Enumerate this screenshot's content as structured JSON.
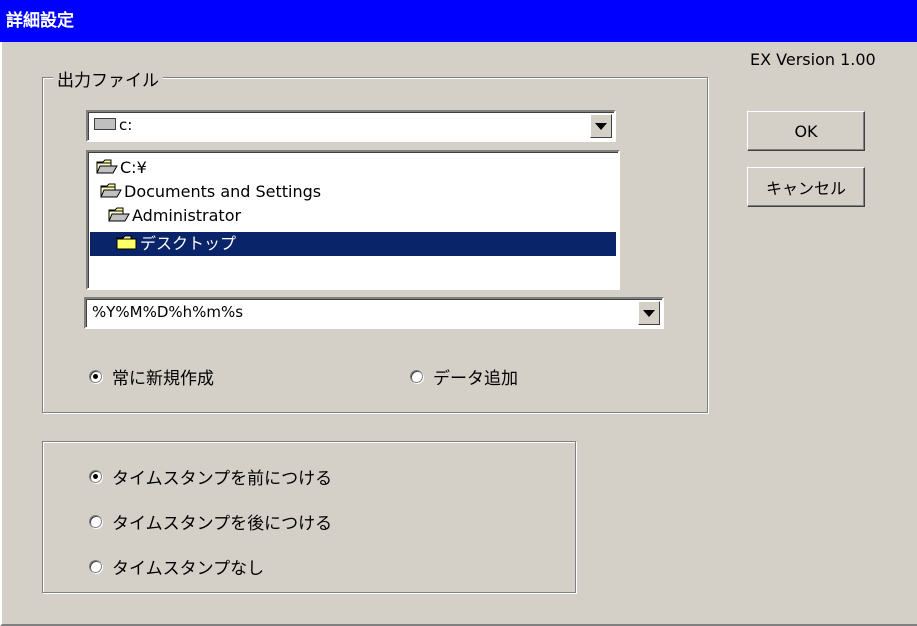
{
  "window": {
    "title": "詳細設定",
    "version": "EX Version 1.00"
  },
  "output_group": {
    "legend": "出力ファイル",
    "drive": {
      "value": "c:",
      "icon": "drive-icon"
    },
    "directories": [
      {
        "label": "C:¥",
        "icon": "open-folder-icon",
        "selected": false
      },
      {
        "label": "Documents and Settings",
        "icon": "open-folder-icon",
        "selected": false
      },
      {
        "label": "Administrator",
        "icon": "open-folder-icon",
        "selected": false
      },
      {
        "label": "デスクトップ",
        "icon": "folder-icon",
        "selected": true
      }
    ],
    "filename_format": "%Y%M%D%h%m%s",
    "mode_options": [
      {
        "label": "常に新規作成",
        "checked": true
      },
      {
        "label": "データ追加",
        "checked": false
      }
    ]
  },
  "timestamp_group": {
    "options": [
      {
        "label": "タイムスタンプを前につける",
        "checked": true
      },
      {
        "label": "タイムスタンプを後につける",
        "checked": false
      },
      {
        "label": "タイムスタンプなし",
        "checked": false
      }
    ]
  },
  "buttons": {
    "ok": "OK",
    "cancel": "キャンセル"
  },
  "colors": {
    "titlebar": "#0000ff",
    "selection": "#0a246a",
    "face": "#d4d0c8"
  }
}
